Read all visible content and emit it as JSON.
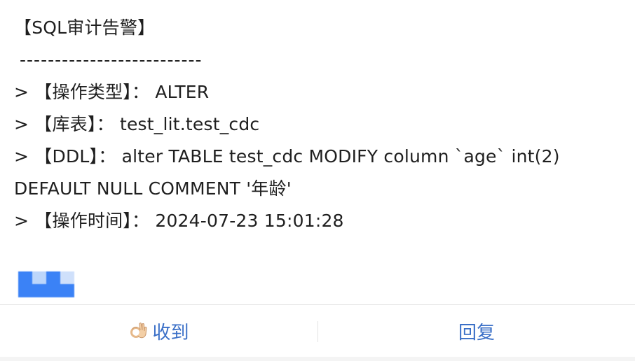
{
  "message": {
    "title": "【SQL审计告警】",
    "divider": "--------------------------",
    "lines": {
      "op_type": "> 【操作类型】： ALTER",
      "table": "> 【库表】： test_lit.test_cdc",
      "ddl_1": "> 【DDL】： alter TABLE test_cdc MODIFY column  `age` int(2)",
      "ddl_2": "DEFAULT NULL COMMENT '年龄'",
      "op_time": "> 【操作时间】： 2024-07-23 15:01:28"
    }
  },
  "actions": {
    "received_label": "收到",
    "reply_label": "回复",
    "received_icon": "ok-hand-icon"
  },
  "colors": {
    "action_text": "#3a6fc7",
    "avatar_blue": "#3b82f6",
    "avatar_light": "#bcd6fb",
    "text": "#1f1f1f"
  }
}
